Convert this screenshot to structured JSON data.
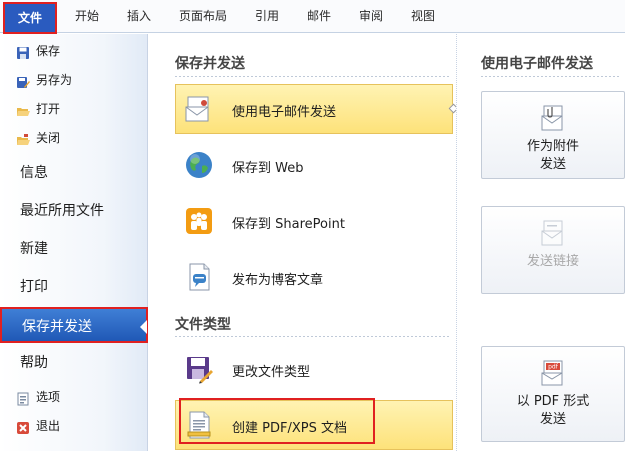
{
  "ribbon": {
    "tabs": [
      "文件",
      "开始",
      "插入",
      "页面布局",
      "引用",
      "邮件",
      "审阅",
      "视图"
    ]
  },
  "leftnav": {
    "commands": {
      "save": "保存",
      "saveas": "另存为",
      "open": "打开",
      "close": "关闭"
    },
    "items": {
      "info": "信息",
      "recent": "最近所用文件",
      "new": "新建",
      "print": "打印",
      "send": "保存并发送",
      "help": "帮助"
    },
    "bottom": {
      "options": "选项",
      "exit": "退出"
    }
  },
  "middle": {
    "section1_title": "保存并发送",
    "section2_title": "文件类型",
    "options": {
      "email": "使用电子邮件发送",
      "web": "保存到 Web",
      "sharepoint": "保存到 SharePoint",
      "blog": "发布为博客文章",
      "change_type": "更改文件类型",
      "pdf": "创建 PDF/XPS 文档"
    }
  },
  "right": {
    "title": "使用电子邮件发送",
    "buttons": {
      "attach_line1": "作为附件",
      "attach_line2": "发送",
      "link": "发送链接",
      "pdf_line1": "以 PDF 形式",
      "pdf_line2": "发送"
    }
  },
  "colors": {
    "file_tab": "#2a5bbf",
    "selected_nav": "#2058b6",
    "selected_option": "#fde27a",
    "highlight_outline": "#e02020"
  },
  "icons": [
    "save-icon",
    "saveas-icon",
    "open-icon",
    "close-icon",
    "email-doc-icon",
    "globe-icon",
    "sharepoint-icon",
    "blog-icon",
    "change-filetype-icon",
    "pdf-doc-icon",
    "attachment-icon",
    "link-icon",
    "pdf-icon",
    "options-icon",
    "exit-icon"
  ]
}
